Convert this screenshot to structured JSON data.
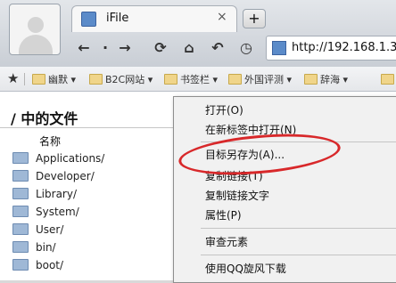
{
  "tab": {
    "title": "iFile",
    "close": "×"
  },
  "toolbar": {
    "new_tab": "+",
    "back": "←",
    "dot": "·",
    "forward": "→",
    "reload": "⟳",
    "home": "⌂",
    "undo": "↶",
    "history": "◷"
  },
  "address_bar": {
    "url": "http://192.168.1.3:"
  },
  "bookmarks": {
    "star": "★",
    "items": [
      {
        "label": "幽默 ▾"
      },
      {
        "label": "B2C网站 ▾"
      },
      {
        "label": "书签栏 ▾"
      },
      {
        "label": "外国评测 ▾"
      },
      {
        "label": "辞海 ▾"
      }
    ]
  },
  "page": {
    "title": "/ 中的文件",
    "column_name": "名称",
    "files": [
      "Applications/",
      "Developer/",
      "Library/",
      "System/",
      "User/",
      "bin/",
      "boot/"
    ]
  },
  "context_menu": {
    "items": [
      "打开(O)",
      "在新标签中打开(N)",
      "目标另存为(A)...",
      "复制链接(T)",
      "复制链接文字",
      "属性(P)",
      "审查元素",
      "使用QQ旋风下载"
    ]
  },
  "highlight_color": "#d8282a"
}
